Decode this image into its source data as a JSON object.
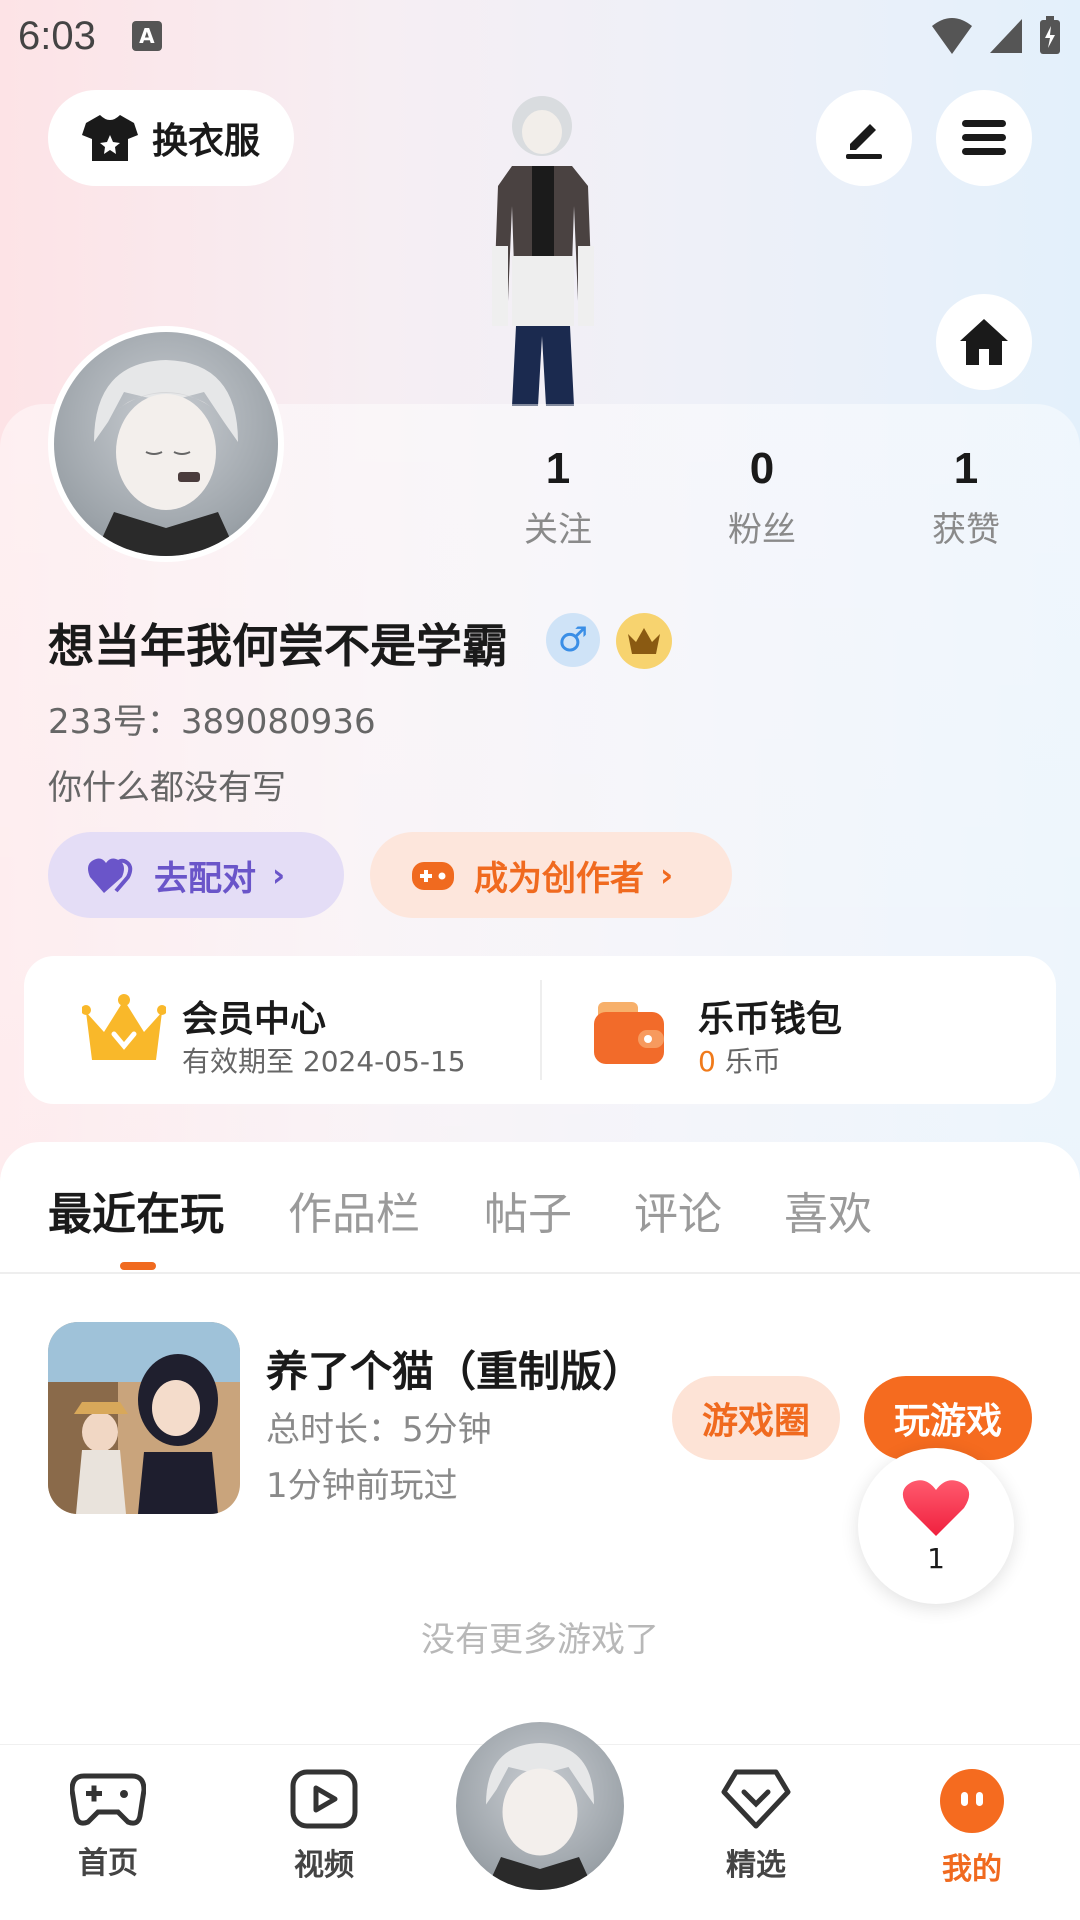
{
  "status_bar": {
    "time": "6:03",
    "a_icon": "A"
  },
  "header": {
    "outfit_label": "换衣服"
  },
  "stats": [
    {
      "num": "1",
      "label": "关注"
    },
    {
      "num": "0",
      "label": "粉丝"
    },
    {
      "num": "1",
      "label": "获赞"
    }
  ],
  "profile": {
    "username": "想当年我何尝不是学霸",
    "gender_symbol": "♂",
    "uid": "233号：389080936",
    "bio": "你什么都没有写"
  },
  "actions": {
    "pair_label": "去配对",
    "creator_label": "成为创作者",
    "chevron": "›"
  },
  "vip": {
    "title": "会员中心",
    "sub": "有效期至 2024-05-15"
  },
  "wallet": {
    "title": "乐币钱包",
    "amount": "0",
    "unit": " 乐币"
  },
  "tabs": [
    "最近在玩",
    "作品栏",
    "帖子",
    "评论",
    "喜欢"
  ],
  "game": {
    "title": "养了个猫（重制版）",
    "duration": "总时长：5分钟",
    "last_played": "1分钟前玩过",
    "circle_btn": "游戏圈",
    "play_btn": "玩游戏"
  },
  "like": {
    "count": "1"
  },
  "no_more": "没有更多游戏了",
  "nav": [
    {
      "label": "首页"
    },
    {
      "label": "视频"
    },
    {
      "label": "精选"
    },
    {
      "label": "我的"
    }
  ],
  "colors": {
    "accent": "#f06a1f",
    "pair_purple": "#6a55c9"
  }
}
